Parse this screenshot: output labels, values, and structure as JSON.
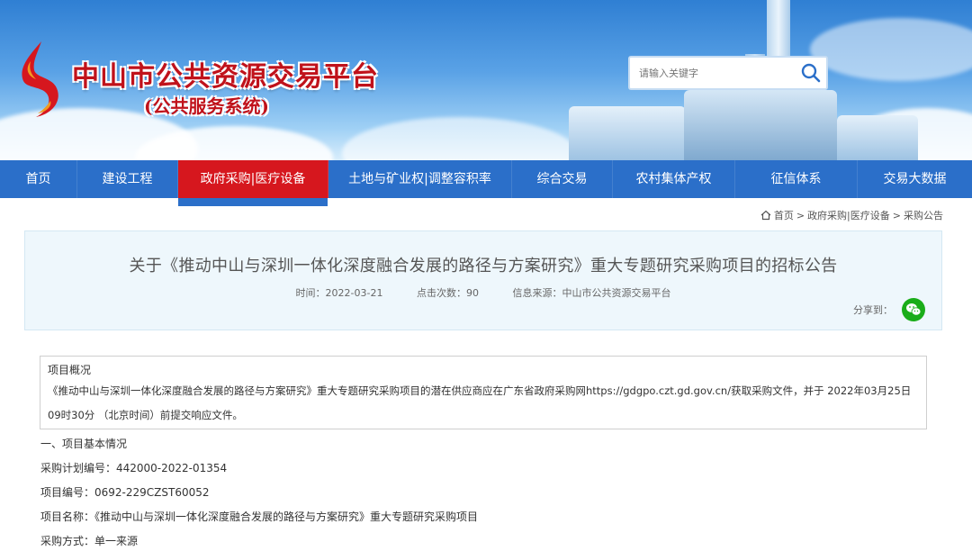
{
  "header": {
    "title": "中山市公共资源交易平台",
    "subtitle": "(公共服务系统)",
    "search_placeholder": "请输入关键字"
  },
  "nav": {
    "items": [
      {
        "label": "首页"
      },
      {
        "label": "建设工程"
      },
      {
        "label": "政府采购|医疗设备"
      },
      {
        "label": "土地与矿业权|调整容积率"
      },
      {
        "label": "综合交易"
      },
      {
        "label": "农村集体产权"
      },
      {
        "label": "征信体系"
      },
      {
        "label": "交易大数据"
      }
    ],
    "active_index": 2
  },
  "breadcrumb": {
    "home": "首页",
    "sep": ">",
    "level1": "政府采购|医疗设备",
    "level2": "采购公告"
  },
  "article": {
    "title": "关于《推动中山与深圳一体化深度融合发展的路径与方案研究》重大专题研究采购项目的招标公告",
    "time_label": "时间：",
    "time": "2022-03-21",
    "clicks_label": "点击次数：",
    "clicks": "90",
    "source_label": "信息来源：",
    "source": "中山市公共资源交易平台",
    "share_label": "分享到："
  },
  "overview": {
    "heading": "项目概况",
    "text": "《推动中山与深圳一体化深度融合发展的路径与方案研究》重大专题研究采购项目的潜在供应商应在广东省政府采购网https://gdgpo.czt.gd.gov.cn/获取采购文件，并于 2022年03月25日 09时30分 （北京时间）前提交响应文件。"
  },
  "content": {
    "section1": "一、项目基本情况",
    "plan_no": "采购计划编号：442000-2022-01354",
    "project_no": "项目编号：0692-229CZST60052",
    "project_name": "项目名称：《推动中山与深圳一体化深度融合发展的路径与方案研究》重大专题研究采购项目",
    "method": "采购方式：单一来源"
  },
  "colors": {
    "nav_bg": "#2b6fc9",
    "nav_active": "#d6171e",
    "title_red": "#c0121b",
    "wechat_green": "#1aad19"
  }
}
